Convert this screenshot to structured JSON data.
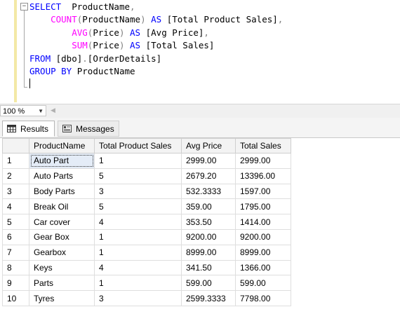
{
  "editor": {
    "lines": [
      {
        "parts": [
          {
            "t": "SELECT",
            "c": "kw"
          },
          {
            "t": "  ProductName",
            "c": ""
          },
          {
            "t": ",",
            "c": "op"
          }
        ]
      },
      {
        "parts": [
          {
            "t": "    ",
            "c": ""
          },
          {
            "t": "COUNT",
            "c": "fn"
          },
          {
            "t": "(",
            "c": "op"
          },
          {
            "t": "ProductName",
            "c": ""
          },
          {
            "t": ")",
            "c": "op"
          },
          {
            "t": " ",
            "c": ""
          },
          {
            "t": "AS",
            "c": "kw"
          },
          {
            "t": " [Total Product Sales]",
            "c": ""
          },
          {
            "t": ",",
            "c": "op"
          }
        ]
      },
      {
        "parts": [
          {
            "t": "        ",
            "c": ""
          },
          {
            "t": "AVG",
            "c": "fn"
          },
          {
            "t": "(",
            "c": "op"
          },
          {
            "t": "Price",
            "c": ""
          },
          {
            "t": ")",
            "c": "op"
          },
          {
            "t": " ",
            "c": ""
          },
          {
            "t": "AS",
            "c": "kw"
          },
          {
            "t": " [Avg Price]",
            "c": ""
          },
          {
            "t": ",",
            "c": "op"
          }
        ]
      },
      {
        "parts": [
          {
            "t": "        ",
            "c": ""
          },
          {
            "t": "SUM",
            "c": "fn"
          },
          {
            "t": "(",
            "c": "op"
          },
          {
            "t": "Price",
            "c": ""
          },
          {
            "t": ")",
            "c": "op"
          },
          {
            "t": " ",
            "c": ""
          },
          {
            "t": "AS",
            "c": "kw"
          },
          {
            "t": " [Total Sales]",
            "c": ""
          }
        ]
      },
      {
        "parts": [
          {
            "t": "FROM",
            "c": "kw"
          },
          {
            "t": " [dbo]",
            "c": ""
          },
          {
            "t": ".",
            "c": "op"
          },
          {
            "t": "[OrderDetails]",
            "c": ""
          }
        ]
      },
      {
        "parts": [
          {
            "t": "GROUP BY",
            "c": "kw"
          },
          {
            "t": " ProductName",
            "c": ""
          }
        ]
      },
      {
        "parts": [
          {
            "t": "",
            "c": "caret"
          }
        ]
      }
    ]
  },
  "zoom": {
    "value": "100 %"
  },
  "tabs": [
    {
      "label": "Results",
      "icon": "results-grid-icon",
      "active": true
    },
    {
      "label": "Messages",
      "icon": "messages-icon",
      "active": false
    }
  ],
  "grid": {
    "columns": [
      "ProductName",
      "Total Product Sales",
      "Avg Price",
      "Total Sales"
    ],
    "rows": [
      [
        "1",
        "Auto Part",
        "1",
        "2999.00",
        "2999.00"
      ],
      [
        "2",
        "Auto Parts",
        "5",
        "2679.20",
        "13396.00"
      ],
      [
        "3",
        "Body Parts",
        "3",
        "532.3333",
        "1597.00"
      ],
      [
        "4",
        "Break Oil",
        "5",
        "359.00",
        "1795.00"
      ],
      [
        "5",
        "Car cover",
        "4",
        "353.50",
        "1414.00"
      ],
      [
        "6",
        "Gear Box",
        "1",
        "9200.00",
        "9200.00"
      ],
      [
        "7",
        "Gearbox",
        "1",
        "8999.00",
        "8999.00"
      ],
      [
        "8",
        "Keys",
        "4",
        "341.50",
        "1366.00"
      ],
      [
        "9",
        "Parts",
        "1",
        "599.00",
        "599.00"
      ],
      [
        "10",
        "Tyres",
        "3",
        "2599.3333",
        "7798.00"
      ]
    ]
  }
}
